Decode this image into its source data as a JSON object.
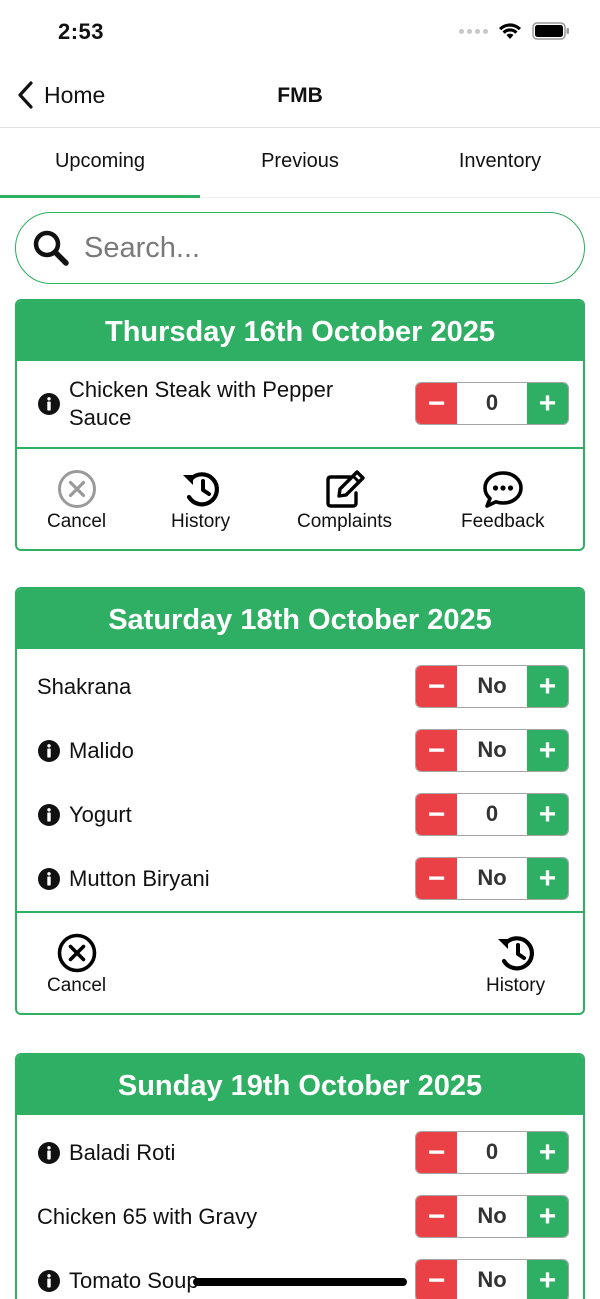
{
  "status_bar": {
    "time": "2:53"
  },
  "nav": {
    "back_label": "Home",
    "title": "FMB"
  },
  "tabs": [
    {
      "label": "Upcoming",
      "active": true
    },
    {
      "label": "Previous",
      "active": false
    },
    {
      "label": "Inventory",
      "active": false
    }
  ],
  "search": {
    "placeholder": "Search..."
  },
  "colors": {
    "accent": "#2faf63",
    "minus": "#ea4146",
    "text": "#111111"
  },
  "days": [
    {
      "date": "Thursday 16th October 2025",
      "items": [
        {
          "name": "Chicken Steak with Pepper Sauce",
          "info": true,
          "value": "0"
        }
      ],
      "actions": [
        {
          "label": "Cancel",
          "icon": "cancel-icon"
        },
        {
          "label": "History",
          "icon": "history-icon"
        },
        {
          "label": "Complaints",
          "icon": "edit-icon"
        },
        {
          "label": "Feedback",
          "icon": "chat-icon"
        }
      ]
    },
    {
      "date": "Saturday 18th October 2025",
      "items": [
        {
          "name": "Shakrana",
          "info": false,
          "value": "No"
        },
        {
          "name": "Malido",
          "info": true,
          "value": "No"
        },
        {
          "name": "Yogurt",
          "info": true,
          "value": "0"
        },
        {
          "name": "Mutton Biryani",
          "info": true,
          "value": "No"
        }
      ],
      "actions": [
        {
          "label": "Cancel",
          "icon": "cancel-icon"
        },
        {
          "label": "History",
          "icon": "history-icon"
        }
      ]
    },
    {
      "date": "Sunday 19th October 2025",
      "items": [
        {
          "name": "Baladi Roti",
          "info": true,
          "value": "0"
        },
        {
          "name": "Chicken 65 with Gravy",
          "info": false,
          "value": "No"
        },
        {
          "name": "Tomato Soup",
          "info": true,
          "value": "No"
        }
      ]
    }
  ]
}
